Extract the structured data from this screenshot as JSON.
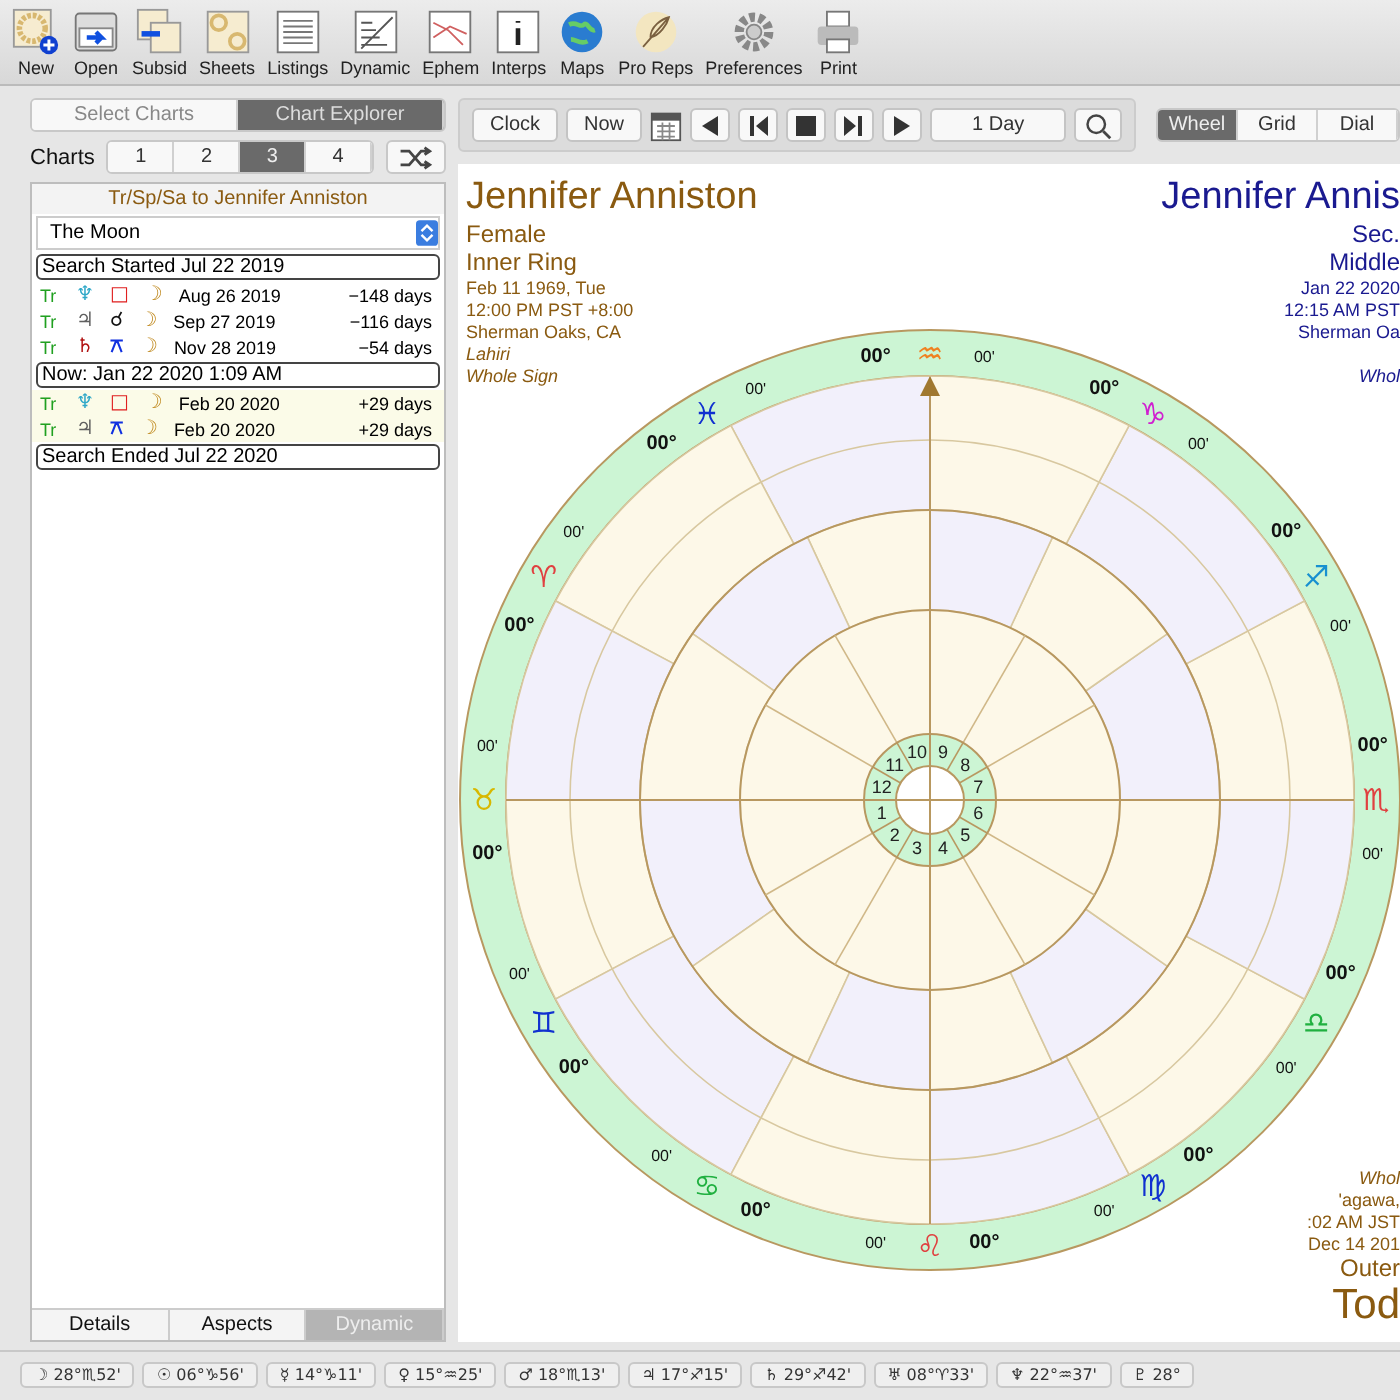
{
  "toolbar": [
    {
      "label": "New",
      "kind": "wheel-plus"
    },
    {
      "label": "Open",
      "kind": "folder"
    },
    {
      "label": "Subsid",
      "kind": "stack"
    },
    {
      "label": "Sheets",
      "kind": "sheets"
    },
    {
      "label": "Listings",
      "kind": "list"
    },
    {
      "label": "Dynamic",
      "kind": "graph"
    },
    {
      "label": "Ephem",
      "kind": "ephem"
    },
    {
      "label": "Interps",
      "kind": "info"
    },
    {
      "label": "Maps",
      "kind": "globe"
    },
    {
      "label": "Pro Reps",
      "kind": "feather"
    },
    {
      "label": "Preferences",
      "kind": "gear"
    },
    {
      "label": "Print",
      "kind": "printer"
    }
  ],
  "mode_tabs": [
    {
      "label": "Select Charts",
      "selected": false
    },
    {
      "label": "Chart Explorer",
      "selected": true
    }
  ],
  "charts": {
    "label": "Charts",
    "tabs": [
      {
        "label": "1",
        "selected": false
      },
      {
        "label": "2",
        "selected": false
      },
      {
        "label": "3",
        "selected": true
      },
      {
        "label": "4",
        "selected": false
      }
    ]
  },
  "explorer": {
    "title": "Tr/Sp/Sa to Jennifer Anniston",
    "dropdown": "The Moon",
    "rows": [
      {
        "kind": "marker",
        "text": "Search Started Jul 22 2019"
      },
      {
        "kind": "event",
        "future": false,
        "type": "Tr",
        "planet": {
          "glyph": "♆",
          "color": "#2fa8c8"
        },
        "aspect": {
          "glyph": "□",
          "color": "#e02020"
        },
        "target": "☽",
        "date": "Aug 26 2019",
        "days": "−148 days"
      },
      {
        "kind": "event",
        "future": false,
        "type": "Tr",
        "planet": {
          "glyph": "♃",
          "color": "#606060"
        },
        "aspect": {
          "glyph": "☌",
          "color": "#111111"
        },
        "target": "☽",
        "date": "Sep 27 2019",
        "days": "−116 days"
      },
      {
        "kind": "event",
        "future": false,
        "type": "Tr",
        "planet": {
          "glyph": "♄",
          "color": "#b01010"
        },
        "aspect": {
          "glyph": "⚻",
          "color": "#1030e0"
        },
        "target": "☽",
        "date": "Nov 28 2019",
        "days": "−54 days"
      },
      {
        "kind": "marker",
        "text": "Now: Jan 22 2020 1:09 AM"
      },
      {
        "kind": "event",
        "future": true,
        "type": "Tr",
        "planet": {
          "glyph": "♆",
          "color": "#2fa8c8"
        },
        "aspect": {
          "glyph": "□",
          "color": "#e02020"
        },
        "target": "☽",
        "date": "Feb 20 2020",
        "days": "+29 days"
      },
      {
        "kind": "event",
        "future": true,
        "type": "Tr",
        "planet": {
          "glyph": "♃",
          "color": "#606060"
        },
        "aspect": {
          "glyph": "⚻",
          "color": "#1030e0"
        },
        "target": "☽",
        "date": "Feb 20 2020",
        "days": "+29 days"
      },
      {
        "kind": "marker",
        "text": "Search Ended Jul 22 2020"
      }
    ],
    "tabs": [
      {
        "label": "Details",
        "selected": false
      },
      {
        "label": "Aspects",
        "selected": false
      },
      {
        "label": "Dynamic",
        "selected": true
      }
    ]
  },
  "nav": {
    "clock": "Clock",
    "now": "Now",
    "step": "1 Day"
  },
  "views": [
    {
      "label": "Wheel",
      "selected": true
    },
    {
      "label": "Grid",
      "selected": false
    },
    {
      "label": "Dial",
      "selected": false
    }
  ],
  "inner_chart": {
    "name": "Jennifer Anniston",
    "lines": [
      "Female",
      "Inner Ring"
    ],
    "details": [
      "Feb 11 1969, Tue",
      "12:00 PM PST +8:00",
      "Sherman Oaks, CA"
    ],
    "notes": [
      "Lahiri",
      "Whole Sign"
    ]
  },
  "middle_chart": {
    "name": "Jennifer Annis",
    "lines": [
      "Sec.",
      "Middle"
    ],
    "details": [
      "Jan 22 2020",
      "12:15 AM PST",
      "Sherman Oa"
    ],
    "notes": [
      "Whol"
    ]
  },
  "outer_chart": {
    "notes": [
      "Whol"
    ],
    "details": [
      "'agawa,",
      ":02 AM JST",
      "Dec 14 201"
    ],
    "lines": [
      "Outer"
    ],
    "name": "Tod"
  },
  "zodiac": [
    {
      "glyph": "♒",
      "degree": "00°",
      "minute": "00'",
      "color": "#f08020"
    },
    {
      "glyph": "♓",
      "degree": "00°",
      "minute": "00'",
      "color": "#1030d0"
    },
    {
      "glyph": "♈",
      "degree": "00°",
      "minute": "00'",
      "color": "#e04040"
    },
    {
      "glyph": "♉",
      "degree": "00°",
      "minute": "00'",
      "color": "#d8b800"
    },
    {
      "glyph": "♊",
      "degree": "00°",
      "minute": "00'",
      "color": "#1030d0"
    },
    {
      "glyph": "♋",
      "degree": "00°",
      "minute": "00'",
      "color": "#20b040"
    },
    {
      "glyph": "♌",
      "degree": "00°",
      "minute": "00'",
      "color": "#e04040"
    },
    {
      "glyph": "♍",
      "degree": "00°",
      "minute": "00'",
      "color": "#1030d0"
    },
    {
      "glyph": "♎",
      "degree": "00°",
      "minute": "00'",
      "color": "#20b040"
    },
    {
      "glyph": "♏",
      "degree": "00°",
      "minute": "00'",
      "color": "#e04040"
    },
    {
      "glyph": "♐",
      "degree": "00°",
      "minute": "00'",
      "color": "#1890d0"
    },
    {
      "glyph": "♑",
      "degree": "00°",
      "minute": "00'",
      "color": "#d020d0"
    }
  ],
  "houses": [
    "1",
    "2",
    "3",
    "4",
    "5",
    "6",
    "7",
    "8",
    "9",
    "10",
    "11",
    "12"
  ],
  "positions": [
    {
      "planet": "☽",
      "text": "28°♏52'"
    },
    {
      "planet": "☉",
      "text": "06°♑56'"
    },
    {
      "planet": "☿",
      "text": "14°♑11'"
    },
    {
      "planet": "♀",
      "text": "15°♒25'"
    },
    {
      "planet": "♂",
      "text": "18°♏13'"
    },
    {
      "planet": "♃",
      "text": "17°♐15'"
    },
    {
      "planet": "♄",
      "text": "29°♐42'"
    },
    {
      "planet": "♅",
      "text": "08°♈33'"
    },
    {
      "planet": "♆",
      "text": "22°♒37'"
    },
    {
      "planet": "♇",
      "text": "28°"
    }
  ]
}
